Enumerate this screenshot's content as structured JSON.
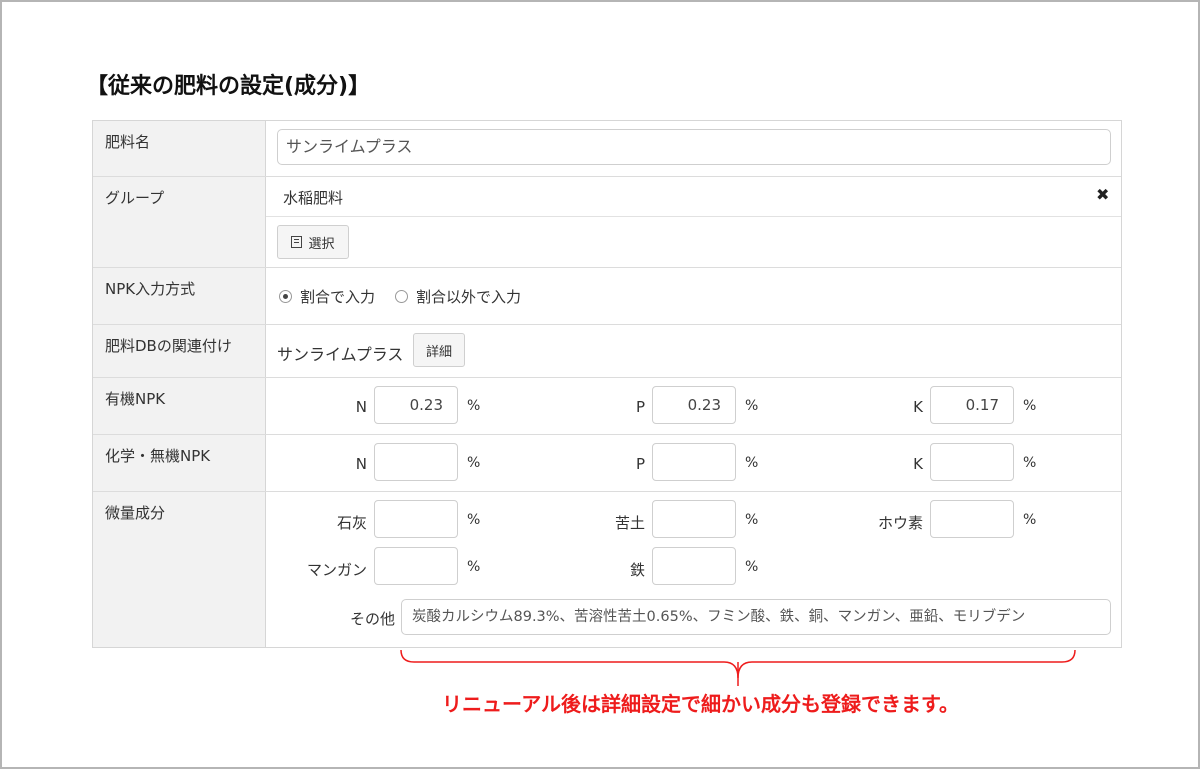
{
  "title": "【従来の肥料の設定(成分)】",
  "accent_color": "#ee1c1c",
  "rows": {
    "name": {
      "label": "肥料名",
      "value": "サンライムプラス"
    },
    "group": {
      "label": "グループ",
      "value": "水稲肥料",
      "select_button": "選択"
    },
    "npk_mode": {
      "label": "NPK入力方式",
      "options": [
        "割合で入力",
        "割合以外で入力"
      ],
      "selected": 0
    },
    "db": {
      "label": "肥料DBの関連付け",
      "value": "サンライムプラス",
      "detail_button": "詳細"
    },
    "organic": {
      "label": "有機NPK",
      "n": "0.23",
      "p": "0.23",
      "k": "0.17"
    },
    "chemical": {
      "label": "化学・無機NPK",
      "n": "",
      "p": "",
      "k": ""
    },
    "trace": {
      "label": "微量成分",
      "lime_label": "石灰",
      "lime": "",
      "magnesia_label": "苦土",
      "magnesia": "",
      "boron_label": "ホウ素",
      "boron": "",
      "manganese_label": "マンガン",
      "manganese": "",
      "iron_label": "鉄",
      "iron": "",
      "other_label": "その他",
      "other": "炭酸カルシウム89.3%、苦溶性苦土0.65%、フミン酸、鉄、銅、マンガン、亜鉛、モリブデン"
    }
  },
  "labels": {
    "n": "N",
    "p": "P",
    "k": "K",
    "percent": "%"
  },
  "note": "リニューアル後は詳細設定で細かい成分も登録できます。"
}
